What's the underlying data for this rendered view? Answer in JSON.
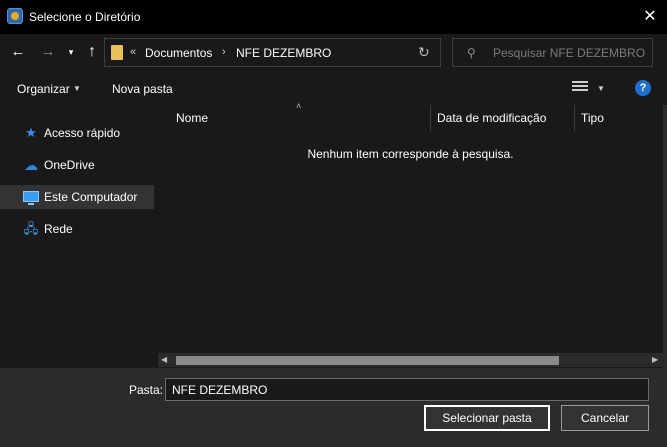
{
  "window": {
    "title": "Selecione o Diretório",
    "close_glyph": "✕"
  },
  "nav": {
    "back_glyph": "←",
    "forward_glyph": "→",
    "recent_glyph": "▾",
    "up_glyph": "↑"
  },
  "address": {
    "overflow_glyph": "«",
    "separator_glyph": "›",
    "crumbs": [
      "Documentos",
      "NFE DEZEMBRO"
    ],
    "refresh_glyph": "↻"
  },
  "search": {
    "placeholder": "Pesquisar NFE DEZEMBRO",
    "icon_glyph": "⚲"
  },
  "toolbar": {
    "organize_label": "Organizar",
    "organize_arrow": "▼",
    "new_folder_label": "Nova pasta",
    "view_arrow": "▼",
    "help_glyph": "?"
  },
  "sidebar": {
    "items": [
      {
        "label": "Acesso rápido",
        "icon": "star-icon",
        "glyph": "★",
        "selected": false
      },
      {
        "label": "OneDrive",
        "icon": "cloud-icon",
        "glyph": "☁",
        "selected": false
      },
      {
        "label": "Este Computador",
        "icon": "computer-icon",
        "glyph": "",
        "selected": true
      },
      {
        "label": "Rede",
        "icon": "network-icon",
        "glyph": "🖧",
        "selected": false
      }
    ]
  },
  "content": {
    "sort_glyph": "˄",
    "columns": [
      "Nome",
      "Data de modificação",
      "Tipo"
    ],
    "empty_message": "Nenhum item corresponde à pesquisa.",
    "scroll_left_glyph": "◀",
    "scroll_right_glyph": "▶"
  },
  "footer": {
    "folder_label": "Pasta:",
    "folder_value": "NFE DEZEMBRO",
    "select_button": "Selecionar pasta",
    "cancel_button": "Cancelar"
  },
  "colors": {
    "background": "#191919",
    "footer": "#2b2b2b",
    "accent": "#1f6fd1",
    "selected_item": "#333333"
  }
}
